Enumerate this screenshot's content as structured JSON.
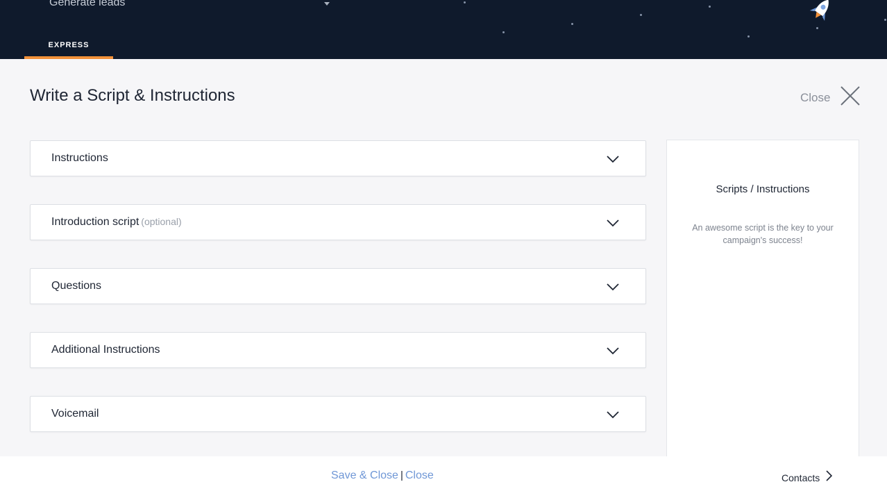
{
  "header": {
    "campaign_select_value": "Generate leads",
    "tabs": [
      {
        "label": "EXPRESS",
        "active": true
      }
    ],
    "accent_color": "#f2913a",
    "background_color": "#0f1a2c"
  },
  "main": {
    "title": "Write a Script & Instructions",
    "close_label": "Close",
    "sections": [
      {
        "label": "Instructions",
        "hint": ""
      },
      {
        "label": "Introduction script",
        "hint": "(optional)"
      },
      {
        "label": "Questions",
        "hint": ""
      },
      {
        "label": "Additional Instructions",
        "hint": ""
      },
      {
        "label": "Voicemail",
        "hint": ""
      }
    ]
  },
  "side_panel": {
    "title": "Scripts / Instructions",
    "text": "An awesome script is the key to your campaign's success!"
  },
  "footer": {
    "save_close_label": "Save & Close",
    "separator": "|",
    "close_label": "Close",
    "next_label": "Contacts",
    "link_color": "#6f97d6"
  },
  "icons": {
    "dropdown": "chevron-down-icon",
    "close": "close-icon",
    "rocket": "rocket-icon",
    "accordion": "chevron-down-icon",
    "next": "chevron-right-icon"
  }
}
